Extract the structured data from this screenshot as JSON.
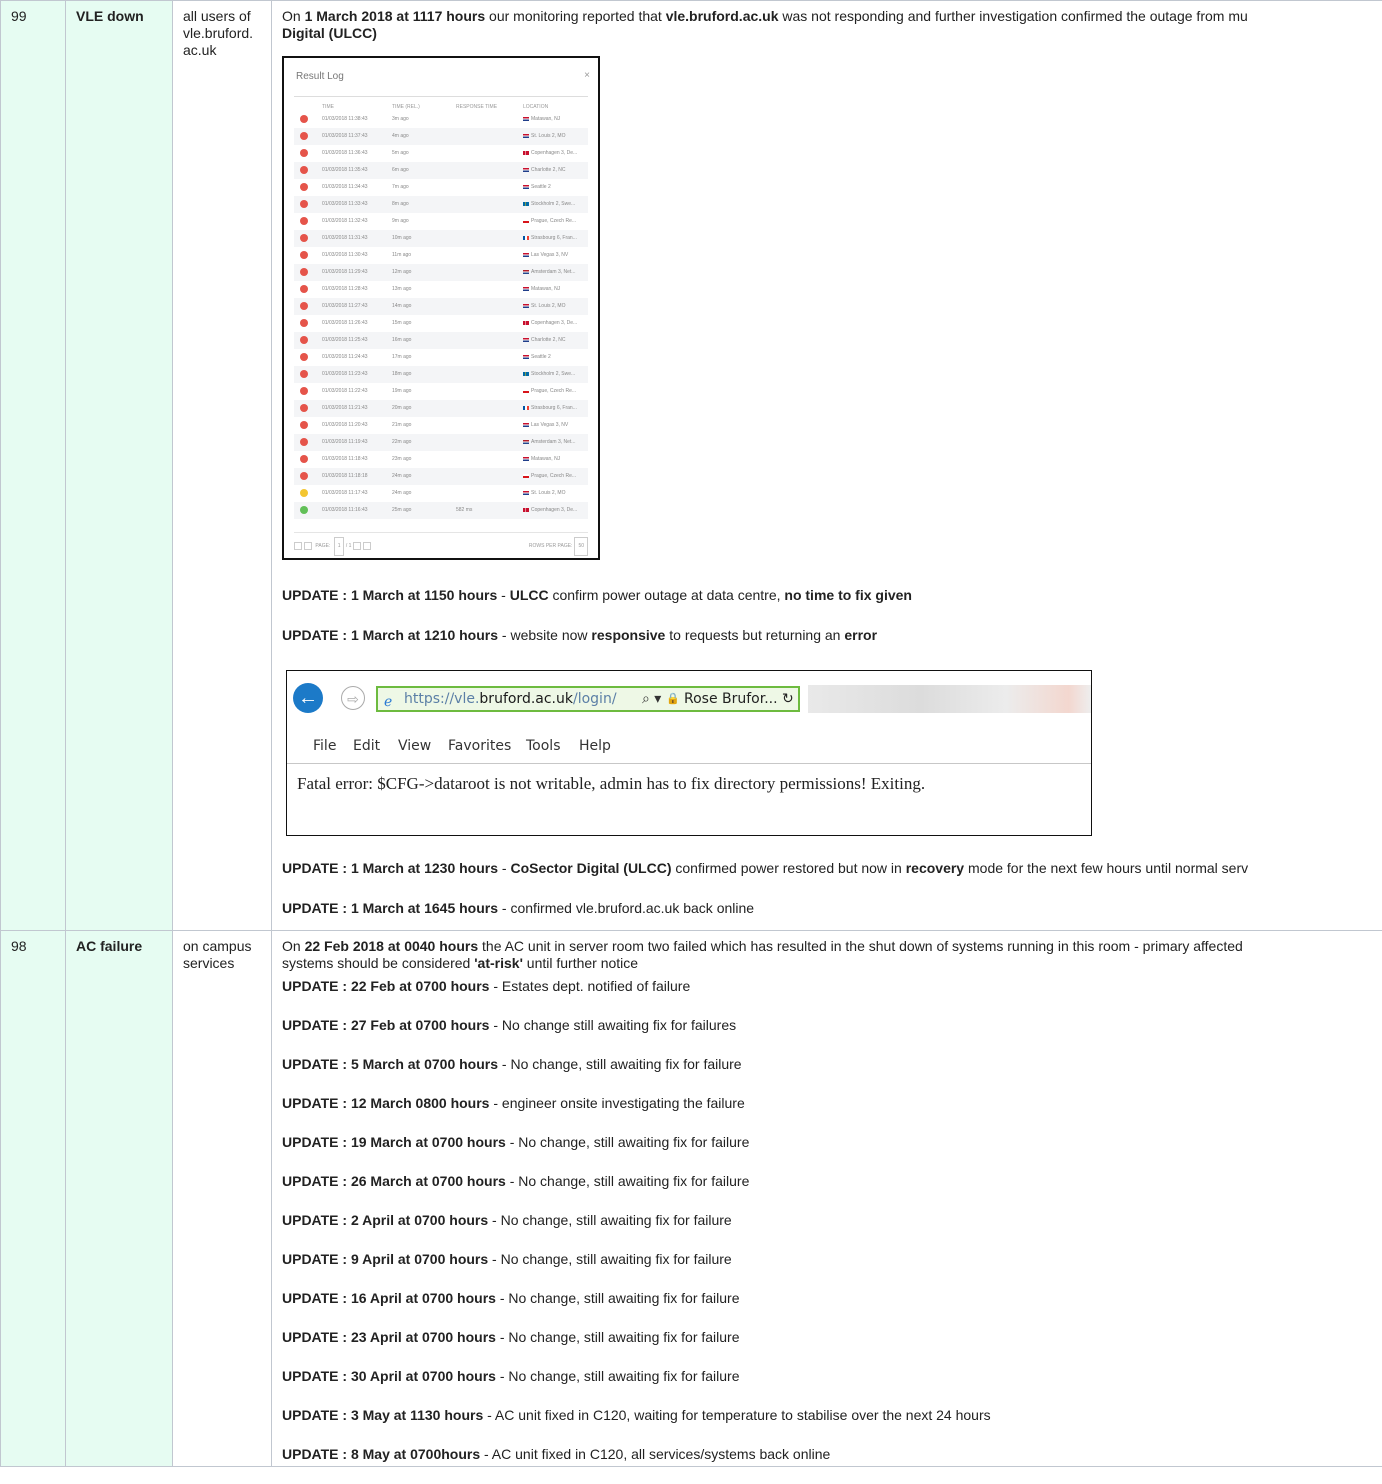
{
  "incidents": [
    {
      "number": "99",
      "title": "VLE down",
      "affected": [
        "all users of",
        "vle.bruford.",
        "ac.uk"
      ],
      "intro": {
        "p1": "On ",
        "b1": "1 March 2018 at 1117 hours",
        "p2": " our monitoring reported that ",
        "b2": "vle.bruford.ac.uk",
        "p3": " was not responding and further investigation confirmed the outage from mu",
        "b3": "Digital (ULCC)"
      },
      "updates": [
        {
          "when": "UPDATE : 1 March at 1150 hours",
          "sep": " - ",
          "b1": "ULCC",
          "t1": " confirm power outage at data centre, ",
          "b2": "no time to fix given",
          "t2": ""
        },
        {
          "when": "UPDATE : 1 March at 1210 hours",
          "sep": " - ",
          "t0": "website now ",
          "b1": "responsive",
          "t1": " to requests but returning an ",
          "b2": "error",
          "t2": ""
        },
        {
          "when": "UPDATE : 1 March at 1230 hours",
          "sep": " - ",
          "b1": "CoSector Digital (ULCC)",
          "t1": " confirmed power restored but now in ",
          "b2": "recovery",
          "t2": " mode for the next few hours until normal serv"
        },
        {
          "when": "UPDATE : 1 March at 1645 hours",
          "sep": " - ",
          "t0": "confirmed vle.bruford.ac.uk back online"
        }
      ]
    },
    {
      "number": "98",
      "title": "AC failure",
      "affected": [
        "on campus",
        "services"
      ],
      "intro": {
        "p1": "On ",
        "b1": "22 Feb 2018 at 0040 hours",
        "p2": " the AC unit in server room two failed which has resulted in the shut down of systems running in this room - primary affected",
        "p3": "systems should be considered ",
        "b2": "'at-risk'",
        "p4": " until further notice"
      },
      "updates": [
        {
          "when": "UPDATE : 22 Feb at 0700 hours",
          "text": " - Estates dept. notified of failure"
        },
        {
          "when": "UPDATE : 27 Feb at 0700 hours",
          "text": " - No change still awaiting fix for failures"
        },
        {
          "when": "UPDATE : 5 March at 0700 hours",
          "text": " - No change, still awaiting fix for failure"
        },
        {
          "when": "UPDATE : 12 March 0800 hours",
          "text": " - engineer onsite investigating the failure"
        },
        {
          "when": "UPDATE : 19 March at 0700 hours",
          "text": " - No change, still awaiting fix for failure"
        },
        {
          "when": "UPDATE : 26 March at 0700 hours",
          "text": " - No change, still awaiting fix for failure"
        },
        {
          "when": "UPDATE : 2 April at 0700 hours",
          "text": " - No change, still awaiting fix for failure"
        },
        {
          "when": "UPDATE : 9 April at 0700 hours",
          "text": " - No change, still awaiting fix for failure"
        },
        {
          "when": "UPDATE : 16 April at 0700 hours",
          "text": " - No change, still awaiting fix for failure"
        },
        {
          "when": "UPDATE : 23 April at 0700 hours",
          "text": " - No change, still awaiting fix for failure"
        },
        {
          "when": "UPDATE : 30 April at 0700 hours",
          "text": " - No change, still awaiting fix for failure"
        },
        {
          "when": "UPDATE : 3 May at 1130 hours",
          "text": " - AC unit fixed in C120, waiting for temperature to stabilise over the next 24 hours"
        },
        {
          "when": "UPDATE : 8 May at 0700hours",
          "text": " - AC unit fixed in C120, all services/systems back online"
        }
      ]
    }
  ],
  "result_log": {
    "title": "Result Log",
    "close": "×",
    "columns": {
      "time": "TIME",
      "rel": "TIME (REL.)",
      "resp": "RESPONSE TIME",
      "loc": "LOCATION"
    },
    "rows": [
      {
        "status": "red",
        "time": "01/03/2018 11:38:43",
        "rel": "3m ago",
        "resp": "",
        "loc": "Matawan, NJ",
        "flag": "us"
      },
      {
        "status": "red",
        "time": "01/03/2018 11:37:43",
        "rel": "4m ago",
        "resp": "",
        "loc": "St. Louis 2, MO",
        "flag": "us"
      },
      {
        "status": "red",
        "time": "01/03/2018 11:36:43",
        "rel": "5m ago",
        "resp": "",
        "loc": "Copenhagen 3, De...",
        "flag": "dk"
      },
      {
        "status": "red",
        "time": "01/03/2018 11:35:43",
        "rel": "6m ago",
        "resp": "",
        "loc": "Charlotte 2, NC",
        "flag": "us"
      },
      {
        "status": "red",
        "time": "01/03/2018 11:34:43",
        "rel": "7m ago",
        "resp": "",
        "loc": "Seattle 2",
        "flag": "us"
      },
      {
        "status": "red",
        "time": "01/03/2018 11:33:43",
        "rel": "8m ago",
        "resp": "",
        "loc": "Stockholm 2, Swe...",
        "flag": "se"
      },
      {
        "status": "red",
        "time": "01/03/2018 11:32:43",
        "rel": "9m ago",
        "resp": "",
        "loc": "Prague, Czech Re...",
        "flag": "cz"
      },
      {
        "status": "red",
        "time": "01/03/2018 11:31:43",
        "rel": "10m ago",
        "resp": "",
        "loc": "Strasbourg 6, Fran...",
        "flag": "fr"
      },
      {
        "status": "red",
        "time": "01/03/2018 11:30:43",
        "rel": "11m ago",
        "resp": "",
        "loc": "Las Vegas 3, NV",
        "flag": "us"
      },
      {
        "status": "red",
        "time": "01/03/2018 11:29:43",
        "rel": "12m ago",
        "resp": "",
        "loc": "Amsterdam 3, Net...",
        "flag": "nl"
      },
      {
        "status": "red",
        "time": "01/03/2018 11:28:43",
        "rel": "13m ago",
        "resp": "",
        "loc": "Matawan, NJ",
        "flag": "us"
      },
      {
        "status": "red",
        "time": "01/03/2018 11:27:43",
        "rel": "14m ago",
        "resp": "",
        "loc": "St. Louis 2, MO",
        "flag": "us"
      },
      {
        "status": "red",
        "time": "01/03/2018 11:26:43",
        "rel": "15m ago",
        "resp": "",
        "loc": "Copenhagen 3, De...",
        "flag": "dk"
      },
      {
        "status": "red",
        "time": "01/03/2018 11:25:43",
        "rel": "16m ago",
        "resp": "",
        "loc": "Charlotte 2, NC",
        "flag": "us"
      },
      {
        "status": "red",
        "time": "01/03/2018 11:24:43",
        "rel": "17m ago",
        "resp": "",
        "loc": "Seattle 2",
        "flag": "us"
      },
      {
        "status": "red",
        "time": "01/03/2018 11:23:43",
        "rel": "18m ago",
        "resp": "",
        "loc": "Stockholm 2, Swe...",
        "flag": "se"
      },
      {
        "status": "red",
        "time": "01/03/2018 11:22:43",
        "rel": "19m ago",
        "resp": "",
        "loc": "Prague, Czech Re...",
        "flag": "cz"
      },
      {
        "status": "red",
        "time": "01/03/2018 11:21:43",
        "rel": "20m ago",
        "resp": "",
        "loc": "Strasbourg 6, Fran...",
        "flag": "fr"
      },
      {
        "status": "red",
        "time": "01/03/2018 11:20:43",
        "rel": "21m ago",
        "resp": "",
        "loc": "Las Vegas 3, NV",
        "flag": "us"
      },
      {
        "status": "red",
        "time": "01/03/2018 11:19:43",
        "rel": "22m ago",
        "resp": "",
        "loc": "Amsterdam 3, Net...",
        "flag": "nl"
      },
      {
        "status": "red",
        "time": "01/03/2018 11:18:43",
        "rel": "23m ago",
        "resp": "",
        "loc": "Matawan, NJ",
        "flag": "us"
      },
      {
        "status": "red",
        "time": "01/03/2018 11:18:18",
        "rel": "24m ago",
        "resp": "",
        "loc": "Prague, Czech Re...",
        "flag": "cz"
      },
      {
        "status": "yellow",
        "time": "01/03/2018 11:17:43",
        "rel": "24m ago",
        "resp": "",
        "loc": "St. Louis 2, MO",
        "flag": "us"
      },
      {
        "status": "green",
        "time": "01/03/2018 11:16:43",
        "rel": "25m ago",
        "resp": "582 ms",
        "loc": "Copenhagen 3, De...",
        "flag": "dk"
      }
    ],
    "pager": {
      "page_label": "PAGE:",
      "page": "1",
      "of": "/ 1",
      "rows_label": "ROWS PER PAGE:",
      "rows": "50"
    }
  },
  "browser": {
    "url_host": "https://vle.",
    "url_domain": "bruford.ac.uk",
    "url_path": "/login/",
    "search_icon": "⌕ ▾",
    "site_name": "Rose Brufor... ",
    "refresh": "↻",
    "menu": [
      "File",
      "Edit",
      "View",
      "Favorites",
      "Tools",
      "Help"
    ],
    "error": "Fatal error: $CFG->dataroot is not writable, admin has to fix directory permissions! Exiting."
  },
  "colors": {
    "accent_cell": "#e6fcf2",
    "red": "#e5544a",
    "yellow": "#f3c631",
    "green": "#62c058",
    "address_green": "#6dbb3f",
    "back_blue": "#1c7ac8"
  }
}
